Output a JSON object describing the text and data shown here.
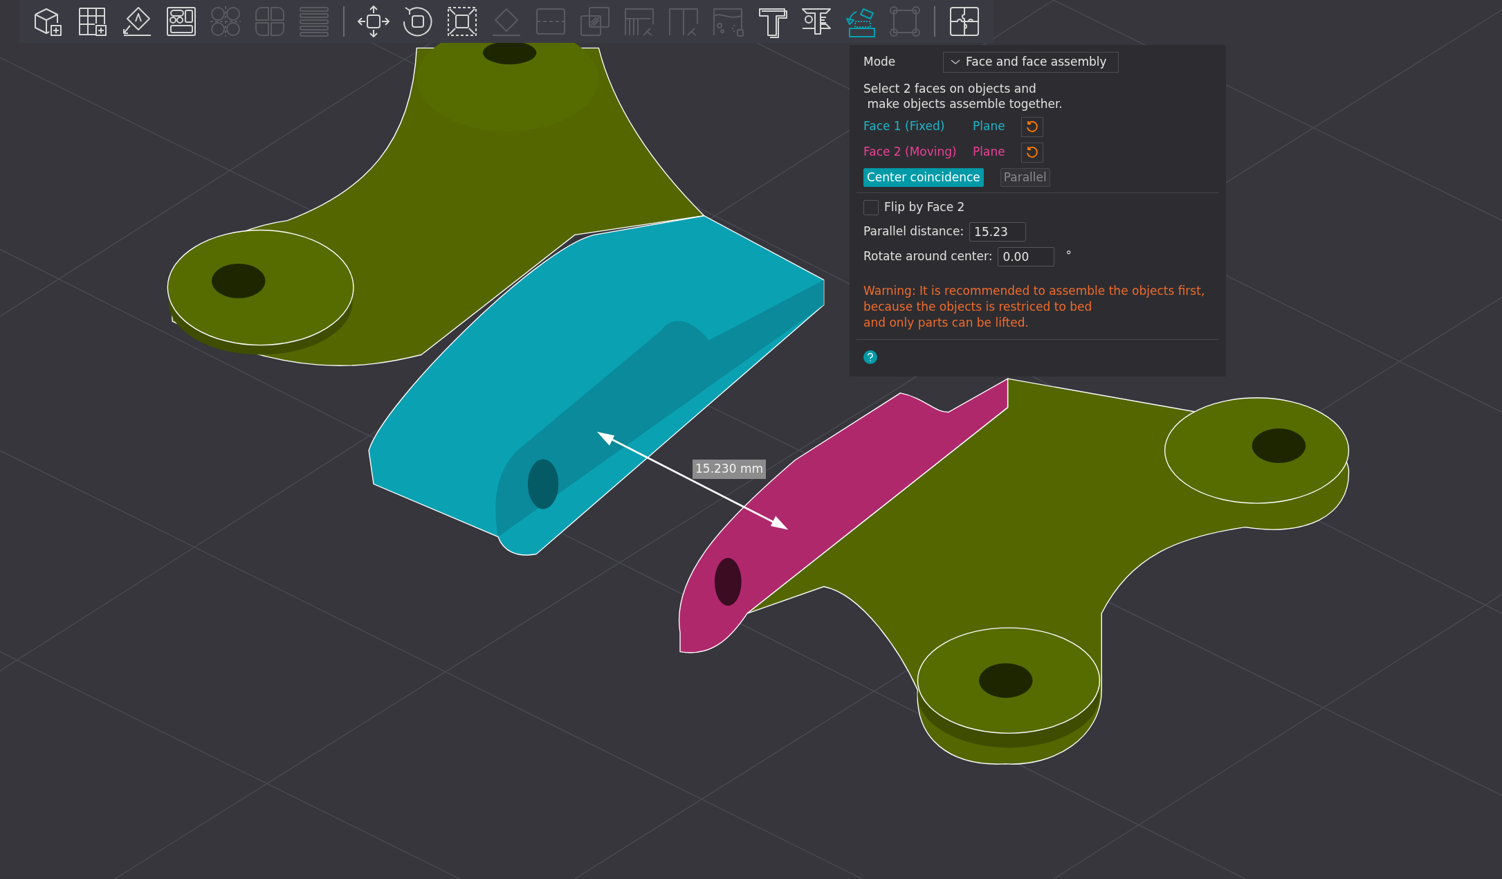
{
  "toolbar": {
    "items": [
      {
        "kind": "tool",
        "disabled": false,
        "selected": false
      },
      {
        "kind": "tool",
        "disabled": false,
        "selected": false
      },
      {
        "kind": "tool",
        "disabled": false,
        "selected": false
      },
      {
        "kind": "tool",
        "disabled": false,
        "selected": false
      },
      {
        "kind": "tool",
        "disabled": true,
        "selected": false
      },
      {
        "kind": "tool",
        "disabled": true,
        "selected": false
      },
      {
        "kind": "tool",
        "disabled": true,
        "selected": false
      },
      {
        "kind": "separator"
      },
      {
        "kind": "tool",
        "disabled": false,
        "selected": false
      },
      {
        "kind": "tool",
        "disabled": false,
        "selected": false
      },
      {
        "kind": "tool",
        "disabled": false,
        "selected": false
      },
      {
        "kind": "tool",
        "disabled": true,
        "selected": false
      },
      {
        "kind": "tool",
        "disabled": true,
        "selected": false
      },
      {
        "kind": "tool",
        "disabled": true,
        "selected": false
      },
      {
        "kind": "tool",
        "disabled": true,
        "selected": false
      },
      {
        "kind": "tool",
        "disabled": true,
        "selected": false
      },
      {
        "kind": "tool",
        "disabled": true,
        "selected": false
      },
      {
        "kind": "tool",
        "disabled": false,
        "selected": false
      },
      {
        "kind": "tool",
        "disabled": false,
        "selected": false
      },
      {
        "kind": "tool",
        "disabled": false,
        "selected": true
      },
      {
        "kind": "tool",
        "disabled": true,
        "selected": false
      },
      {
        "kind": "separator"
      },
      {
        "kind": "tool",
        "disabled": false,
        "selected": false
      }
    ]
  },
  "viewport": {
    "measurement": "15.230 mm"
  },
  "assembly_panel": {
    "mode": {
      "label": "Mode",
      "value": "Face and face assembly"
    },
    "instructions": "Select 2 faces on objects and\n make objects assemble together.",
    "faces": [
      {
        "label": "Face 1 (Fixed)",
        "type": "Plane",
        "color": "#1fb5c9"
      },
      {
        "label": "Face 2 (Moving)",
        "type": "Plane",
        "color": "#ee3f97"
      }
    ],
    "alignment": [
      {
        "label": "Center coincidence",
        "selected": true
      },
      {
        "label": "Parallel",
        "selected": false
      }
    ],
    "flip": {
      "label": "Flip by Face 2",
      "checked": false
    },
    "parallel_distance": {
      "label": "Parallel distance:",
      "value": "15.23"
    },
    "rotate": {
      "label": "Rotate around center:",
      "value": "0.00",
      "unit": "°"
    },
    "warning": "Warning: It is recommended to assemble the objects first,\nbecause the objects is restriced to bed\nand only parts can be lifted."
  }
}
